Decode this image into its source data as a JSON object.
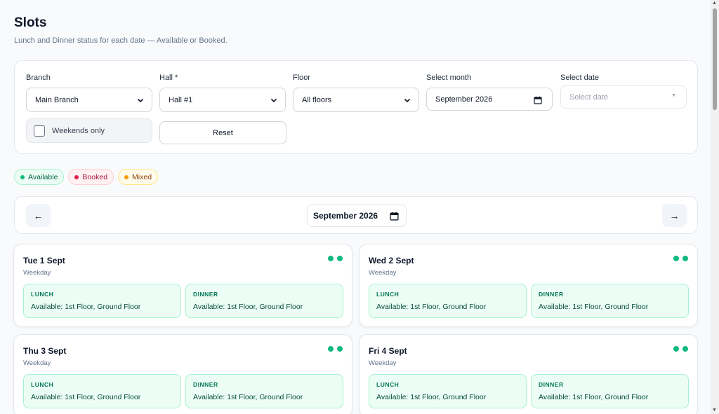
{
  "header": {
    "title": "Slots",
    "subtitle": "Lunch and Dinner status for each date — Available or Booked."
  },
  "filters": {
    "branch_label": "Branch",
    "branch_value": "Main Branch",
    "hall_label": "Hall *",
    "hall_value": "Hall #1",
    "floor_label": "Floor",
    "floor_value": "All floors",
    "month_label": "Select month",
    "month_value": "September 2026",
    "date_label": "Select date",
    "date_placeholder": "Select date",
    "weekends_label": "Weekends only",
    "weekends_checked": false,
    "reset_label": "Reset"
  },
  "legend": {
    "available": "Available",
    "booked": "Booked",
    "mixed": "Mixed"
  },
  "month_nav": {
    "prev": "←",
    "next": "→",
    "month": "September 2026"
  },
  "days": [
    {
      "date": "Tue 1 Sept",
      "type": "Weekday",
      "lunch_label": "LUNCH",
      "lunch_status": "Available: 1st Floor, Ground Floor",
      "dinner_label": "DINNER",
      "dinner_status": "Available: 1st Floor, Ground Floor"
    },
    {
      "date": "Wed 2 Sept",
      "type": "Weekday",
      "lunch_label": "LUNCH",
      "lunch_status": "Available: 1st Floor, Ground Floor",
      "dinner_label": "DINNER",
      "dinner_status": "Available: 1st Floor, Ground Floor"
    },
    {
      "date": "Thu 3 Sept",
      "type": "Weekday",
      "lunch_label": "LUNCH",
      "lunch_status": "Available: 1st Floor, Ground Floor",
      "dinner_label": "DINNER",
      "dinner_status": "Available: 1st Floor, Ground Floor"
    },
    {
      "date": "Fri 4 Sept",
      "type": "Weekday",
      "lunch_label": "LUNCH",
      "lunch_status": "Available: 1st Floor, Ground Floor",
      "dinner_label": "DINNER",
      "dinner_status": "Available: 1st Floor, Ground Floor"
    }
  ],
  "colors": {
    "available": "#10b981",
    "booked": "#e11d48",
    "mixed": "#f59e0b"
  }
}
